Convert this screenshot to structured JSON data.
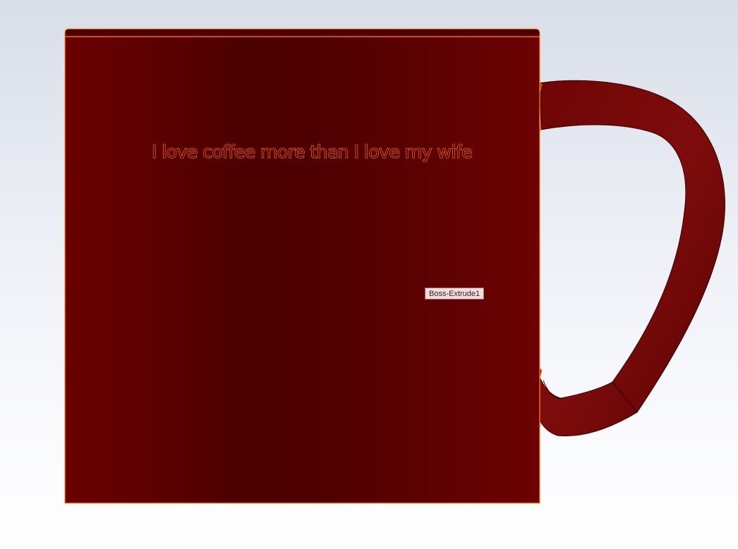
{
  "scene": {
    "background_top": "#d8dde8",
    "background_bottom": "#ffffff"
  },
  "mug": {
    "body_color": "#5e0000",
    "body_dark": "#4a0000",
    "edge_color": "#ff8c1a",
    "handle_color": "#7a0a0a",
    "engraving_text": "I love coffee more than I love my wife"
  },
  "tooltip": {
    "label": "Boss-Extrude1"
  }
}
